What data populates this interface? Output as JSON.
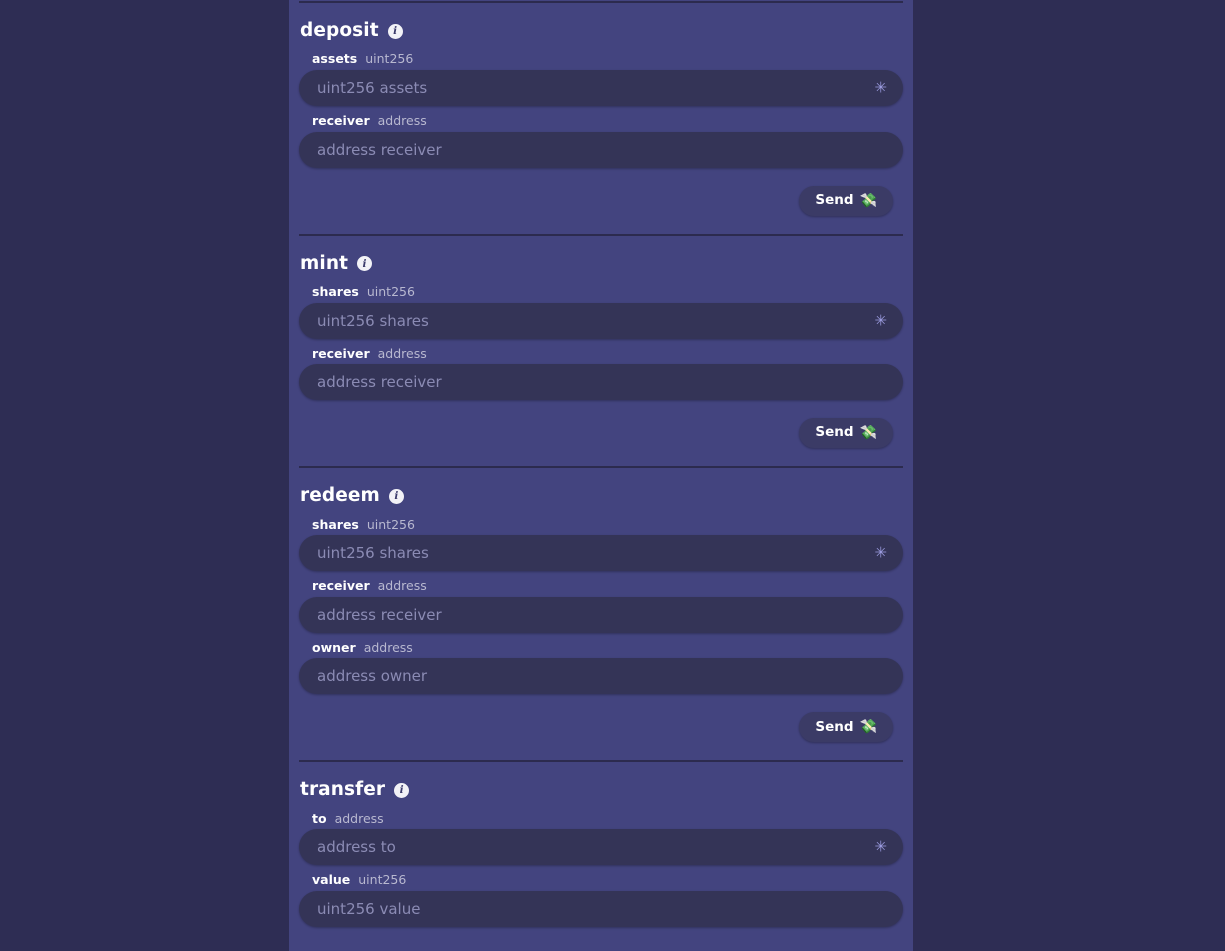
{
  "theme": {
    "page_background": "#2e2d54",
    "card_background": "#43447f",
    "input_background": "#343457",
    "button_background": "#3b3b66",
    "accent_star": "#9c9ce0",
    "divider": "#2c2b4e",
    "placeholder_text": "#8b8bb4",
    "type_text": "#b8b8d0"
  },
  "icons": {
    "info": "i",
    "info_name": "info-icon",
    "required": "✳",
    "send_emoji": "💸"
  },
  "labels": {
    "send": "Send"
  },
  "functions": [
    {
      "name": "deposit",
      "params": [
        {
          "name": "assets",
          "type": "uint256",
          "placeholder": "uint256 assets",
          "value": "",
          "required": true
        },
        {
          "name": "receiver",
          "type": "address",
          "placeholder": "address receiver",
          "value": "",
          "required": false
        }
      ]
    },
    {
      "name": "mint",
      "params": [
        {
          "name": "shares",
          "type": "uint256",
          "placeholder": "uint256 shares",
          "value": "",
          "required": true
        },
        {
          "name": "receiver",
          "type": "address",
          "placeholder": "address receiver",
          "value": "",
          "required": false
        }
      ]
    },
    {
      "name": "redeem",
      "params": [
        {
          "name": "shares",
          "type": "uint256",
          "placeholder": "uint256 shares",
          "value": "",
          "required": true
        },
        {
          "name": "receiver",
          "type": "address",
          "placeholder": "address receiver",
          "value": "",
          "required": false
        },
        {
          "name": "owner",
          "type": "address",
          "placeholder": "address owner",
          "value": "",
          "required": false
        }
      ]
    },
    {
      "name": "transfer",
      "params": [
        {
          "name": "to",
          "type": "address",
          "placeholder": "address to",
          "value": "",
          "required": true
        },
        {
          "name": "value",
          "type": "uint256",
          "placeholder": "uint256 value",
          "value": "",
          "required": false
        }
      ]
    }
  ]
}
